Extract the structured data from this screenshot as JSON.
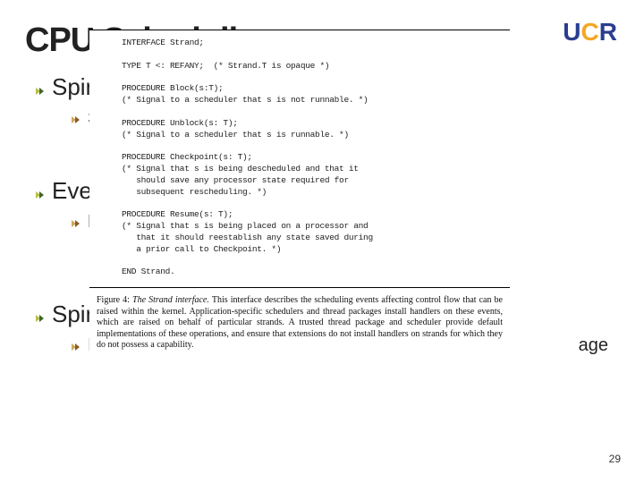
{
  "title": "CPU Scheduling",
  "logo": {
    "u": "U",
    "c": "C",
    "r": "R"
  },
  "bullets": {
    "b1": "Spin",
    "b1a": "Se",
    "b2": "Ever",
    "b2a": "Blo",
    "b3": "Spin",
    "b3a_left": "Int",
    "b3a_right": "age"
  },
  "figure": {
    "code": "INTERFACE Strand;\n\nTYPE T <: REFANY;  (* Strand.T is opaque *)\n\nPROCEDURE Block(s:T);\n(* Signal to a scheduler that s is not runnable. *)\n\nPROCEDURE Unblock(s: T);\n(* Signal to a scheduler that s is runnable. *)\n\nPROCEDURE Checkpoint(s: T);\n(* Signal that s is being descheduled and that it\n   should save any processor state required for\n   subsequent rescheduling. *)\n\nPROCEDURE Resume(s: T);\n(* Signal that s is being placed on a processor and\n   that it should reestablish any state saved during\n   a prior call to Checkpoint. *)\n\nEND Strand.",
    "caption_label": "Figure 4:",
    "caption_title": " The Strand interface. ",
    "caption_body": "This interface describes the scheduling events affecting control flow that can be raised within the kernel. Application-specific schedulers and thread packages install handlers on these events, which are raised on behalf of particular strands. A trusted thread package and scheduler provide default implementations of these operations, and ensure that extensions do not install handlers on strands for which they do not possess a capability."
  },
  "page_number": "29"
}
